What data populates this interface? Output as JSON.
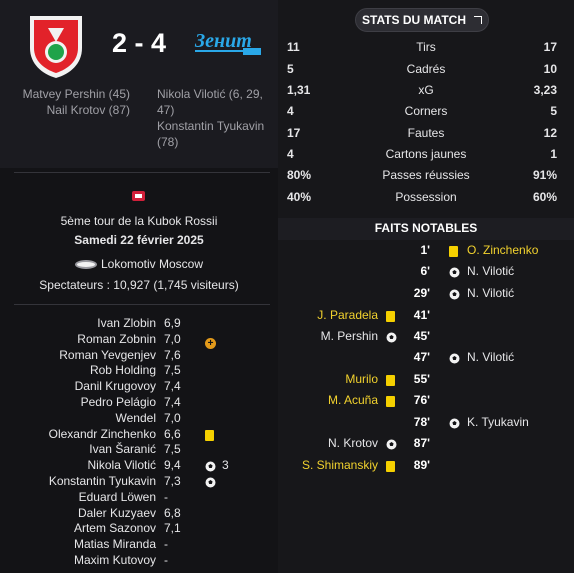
{
  "match": {
    "score": "2 - 4",
    "home_team_logo": "lokomotiv-moscow-crest",
    "away_team_logo": "zenit-crest",
    "home_scorers": [
      "Matvey Pershin (45)",
      "Nail Krotov (87)"
    ],
    "away_scorers": [
      "Nikola Vilotić (6, 29,",
      "47)",
      "Konstantin Tyukavin",
      "(78)"
    ]
  },
  "info": {
    "competition": "5ème tour de la Kubok Rossii",
    "date": "Samedi 22 février 2025",
    "stadium": "Lokomotiv Moscow",
    "attendance": "Spectateurs : 10,927 (1,745 visiteurs)"
  },
  "ratings": [
    {
      "name": "Ivan Zlobin",
      "value": "6,9",
      "event": ""
    },
    {
      "name": "Roman Zobnin",
      "value": "7,0",
      "event": "sub"
    },
    {
      "name": "Roman Yevgenjev",
      "value": "7,6",
      "event": ""
    },
    {
      "name": "Rob Holding",
      "value": "7,5",
      "event": ""
    },
    {
      "name": "Danil Krugovoy",
      "value": "7,4",
      "event": ""
    },
    {
      "name": "Pedro Pelágio",
      "value": "7,4",
      "event": ""
    },
    {
      "name": "Wendel",
      "value": "7,0",
      "event": ""
    },
    {
      "name": "Olexandr Zinchenko",
      "value": "6,6",
      "event": "yellow"
    },
    {
      "name": "Ivan Šaranić",
      "value": "7,5",
      "event": ""
    },
    {
      "name": "Nikola Vilotić",
      "value": "9,4",
      "event": "goal",
      "count": "3"
    },
    {
      "name": "Konstantin Tyukavin",
      "value": "7,3",
      "event": "goal"
    },
    {
      "name": "Eduard Löwen",
      "value": "-",
      "event": ""
    },
    {
      "name": "Daler Kuzyaev",
      "value": "6,8",
      "event": ""
    },
    {
      "name": "Artem Sazonov",
      "value": "7,1",
      "event": ""
    },
    {
      "name": "Matias Miranda",
      "value": "-",
      "event": ""
    },
    {
      "name": "Maxim Kutovoy",
      "value": "-",
      "event": ""
    }
  ],
  "stats_button": {
    "label": "STATS DU MATCH"
  },
  "stats": [
    {
      "label": "Tirs",
      "home": "11",
      "away": "17"
    },
    {
      "label": "Cadrés",
      "home": "5",
      "away": "10"
    },
    {
      "label": "xG",
      "home": "1,31",
      "away": "3,23"
    },
    {
      "label": "Corners",
      "home": "4",
      "away": "5"
    },
    {
      "label": "Fautes",
      "home": "17",
      "away": "12"
    },
    {
      "label": "Cartons jaunes",
      "home": "4",
      "away": "1"
    },
    {
      "label": "Passes réussies",
      "home": "80%",
      "away": "91%"
    },
    {
      "label": "Possession",
      "home": "40%",
      "away": "60%"
    }
  ],
  "faits": {
    "title": "FAITS NOTABLES",
    "events": [
      {
        "minute": "1'",
        "home_player": "",
        "home_type": "",
        "away_player": "O. Zinchenko",
        "away_type": "yellow"
      },
      {
        "minute": "6'",
        "home_player": "",
        "home_type": "",
        "away_player": "N. Vilotić",
        "away_type": "goal"
      },
      {
        "minute": "29'",
        "home_player": "",
        "home_type": "",
        "away_player": "N. Vilotić",
        "away_type": "goal"
      },
      {
        "minute": "41'",
        "home_player": "J. Paradela",
        "home_type": "yellow",
        "away_player": "",
        "away_type": ""
      },
      {
        "minute": "45'",
        "home_player": "M. Pershin",
        "home_type": "goal",
        "away_player": "",
        "away_type": ""
      },
      {
        "minute": "47'",
        "home_player": "",
        "home_type": "",
        "away_player": "N. Vilotić",
        "away_type": "goal"
      },
      {
        "minute": "55'",
        "home_player": "Murilo",
        "home_type": "yellow",
        "away_player": "",
        "away_type": ""
      },
      {
        "minute": "76'",
        "home_player": "M. Acuña",
        "home_type": "yellow",
        "away_player": "",
        "away_type": ""
      },
      {
        "minute": "78'",
        "home_player": "",
        "home_type": "",
        "away_player": "K. Tyukavin",
        "away_type": "goal"
      },
      {
        "minute": "87'",
        "home_player": "N. Krotov",
        "home_type": "goal",
        "away_player": "",
        "away_type": ""
      },
      {
        "minute": "89'",
        "home_player": "S. Shimanskiy",
        "home_type": "yellow",
        "away_player": "",
        "away_type": ""
      }
    ]
  }
}
